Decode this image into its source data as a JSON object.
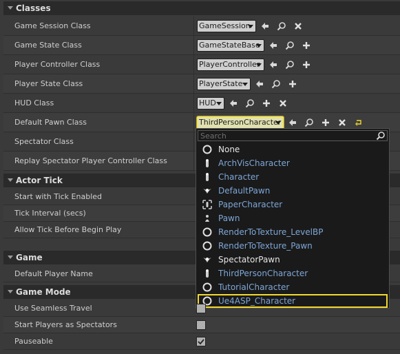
{
  "sections": {
    "classes": "Classes",
    "actor_tick": "Actor Tick",
    "game": "Game",
    "game_mode": "Game Mode"
  },
  "classes_rows": [
    {
      "label": "Game Session Class",
      "value": "GameSession"
    },
    {
      "label": "Game State Class",
      "value": "GameStateBase"
    },
    {
      "label": "Player Controller Class",
      "value": "PlayerController"
    },
    {
      "label": "Player State Class",
      "value": "PlayerState"
    },
    {
      "label": "HUD Class",
      "value": "HUD"
    },
    {
      "label": "Default Pawn Class",
      "value": "ThirdPersonCharacter"
    },
    {
      "label": "Spectator Class",
      "value": ""
    },
    {
      "label": "Replay Spectator Player Controller Class",
      "value": ""
    }
  ],
  "actor_tick_rows": [
    {
      "label": "Start with Tick Enabled"
    },
    {
      "label": "Tick Interval (secs)"
    },
    {
      "label": "Allow Tick Before Begin Play"
    }
  ],
  "game_rows": [
    {
      "label": "Default Player Name"
    }
  ],
  "game_mode_rows": [
    {
      "label": "Use Seamless Travel",
      "checked": false
    },
    {
      "label": "Start Players as Spectators",
      "checked": false
    },
    {
      "label": "Pauseable",
      "checked": true
    }
  ],
  "dropdown": {
    "search_placeholder": "Search",
    "items": [
      {
        "label": "None",
        "icon": "circle-icon",
        "color": "#e6e6e6"
      },
      {
        "label": "ArchVisCharacter",
        "icon": "character-icon",
        "color": "#7ea7d8"
      },
      {
        "label": "Character",
        "icon": "character-icon",
        "color": "#7ea7d8"
      },
      {
        "label": "DefaultPawn",
        "icon": "pawn-icon",
        "color": "#7ea7d8"
      },
      {
        "label": "PaperCharacter",
        "icon": "paper-character-icon",
        "color": "#7ea7d8"
      },
      {
        "label": "Pawn",
        "icon": "pawn-small-icon",
        "color": "#7ea7d8"
      },
      {
        "label": "RenderToTexture_LevelBP",
        "icon": "circle-icon",
        "color": "#7ea7d8"
      },
      {
        "label": "RenderToTexture_Pawn",
        "icon": "circle-icon",
        "color": "#7ea7d8"
      },
      {
        "label": "SpectatorPawn",
        "icon": "pawn-icon",
        "color": "#e6e6e6"
      },
      {
        "label": "ThirdPersonCharacter",
        "icon": "character-icon",
        "color": "#7ea7d8"
      },
      {
        "label": "TutorialCharacter",
        "icon": "circle-icon",
        "color": "#7ea7d8"
      },
      {
        "label": "Ue4ASP_Character",
        "icon": "circle-icon",
        "color": "#7ea7d8",
        "selected": true
      }
    ]
  },
  "colors": {
    "accent": "#f3da2f",
    "link": "#7ea7d8"
  }
}
